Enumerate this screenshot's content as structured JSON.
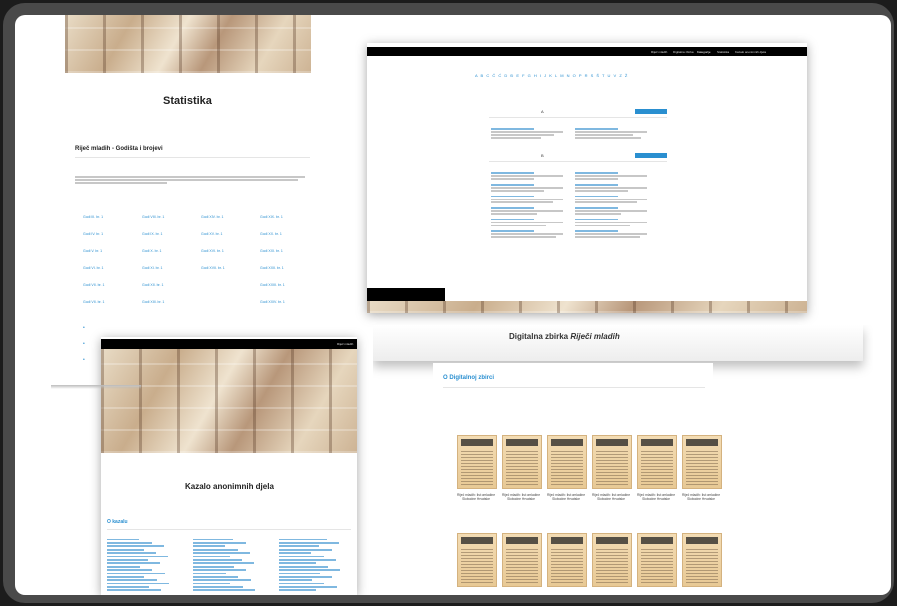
{
  "statistika": {
    "title": "Statistika",
    "section_heading": "Riječ mladih - Godišta i brojevi",
    "volumes": [
      [
        "Godi III. br. 1",
        "Godi VIII. br. 1",
        "Godi XIV. br. 1",
        "Godi XIX. br. 1"
      ],
      [
        "Godi IV. br. 1",
        "Godi IX. br. 1",
        "Godi XV. br. 1",
        "Godi XX. br. 1"
      ],
      [
        "Godi V. br. 1",
        "Godi X. br. 1",
        "Godi XVI. br. 1",
        "Godi XXI. br. 1"
      ],
      [
        "Godi VI. br. 1",
        "Godi XI. br. 1",
        "Godi XVII. br. 1",
        "Godi XXII. br. 1"
      ],
      [
        "Godi VII. br. 1",
        "Godi XII. br. 1",
        "",
        "Godi XXIII. br. 1"
      ],
      [
        "Godi VII. br. 1",
        "Godi XIII. br. 1",
        "",
        "Godi XXIV. br. 1"
      ]
    ]
  },
  "autori": {
    "nav": [
      "Riječ mladih",
      "Digitalna zbirka",
      "Kategorije",
      "Statistika",
      "Kazalo anonimnih djela"
    ],
    "alphabet": "A B C Č Ć D Đ E F G H I J K L M N O P R S Š T U V Z Ž",
    "letter_a": "A",
    "letter_b": "B"
  },
  "digitalna": {
    "title_prefix": "Digitalna zbirka ",
    "title_em": "Riječi mladih",
    "section_heading": "O Digitalnoj zbirci",
    "caption": "Riječ mladih: list omladine Slobodne Hrvatske"
  },
  "kazalo": {
    "nav_link": "Riječ mladih",
    "title": "Kazalo anonimnih djela",
    "section_heading": "O kazalu"
  }
}
